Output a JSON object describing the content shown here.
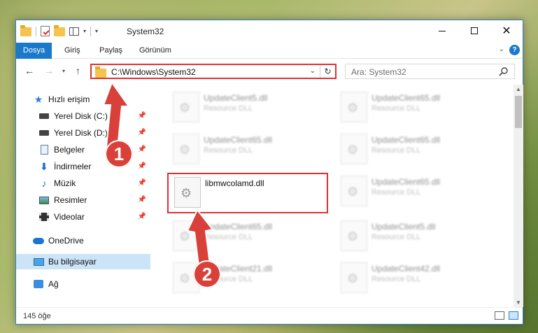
{
  "window": {
    "title": "System32"
  },
  "ribbon": {
    "tabs": [
      "Dosya",
      "Giriş",
      "Paylaş",
      "Görünüm"
    ]
  },
  "address": {
    "path": "C:\\Windows\\System32"
  },
  "search": {
    "placeholder": "Ara: System32"
  },
  "navpane": {
    "items": [
      {
        "label": "Hızlı erişim",
        "icon": "star-icon"
      },
      {
        "label": "Yerel Disk (C:)",
        "icon": "drive-icon",
        "pinned": true
      },
      {
        "label": "Yerel Disk (D:)",
        "icon": "drive-icon",
        "pinned": true
      },
      {
        "label": "Belgeler",
        "icon": "documents-icon",
        "pinned": true
      },
      {
        "label": "İndirmeler",
        "icon": "downloads-icon",
        "pinned": true
      },
      {
        "label": "Müzik",
        "icon": "music-icon",
        "pinned": true
      },
      {
        "label": "Resimler",
        "icon": "pictures-icon",
        "pinned": true
      },
      {
        "label": "Videolar",
        "icon": "videos-icon",
        "pinned": true
      },
      {
        "label": "OneDrive",
        "icon": "onedrive-icon"
      },
      {
        "label": "Bu bilgisayar",
        "icon": "this-pc-icon",
        "selected": true
      },
      {
        "label": "Ağ",
        "icon": "network-icon"
      }
    ]
  },
  "files": [
    {
      "name": "UpdateClient5.dll",
      "type": "Resource DLL"
    },
    {
      "name": "UpdateClient65.dll",
      "type": "Resource DLL"
    },
    {
      "name": "UpdateClient65.dll",
      "type": "Resource DLL"
    },
    {
      "name": "UpdateClient65.dll",
      "type": "Resource DLL"
    },
    {
      "name": "libmwcolamd.dll",
      "type": ""
    },
    {
      "name": "UpdateClient65.dll",
      "type": "Resource DLL"
    },
    {
      "name": "UpdateClient65.dll",
      "type": "Resource DLL"
    },
    {
      "name": "UpdateClient5.dll",
      "type": "Resource DLL"
    },
    {
      "name": "UpdateClient21.dll",
      "type": "Resource DLL"
    },
    {
      "name": "UpdateClient42.dll",
      "type": "Resource DLL"
    }
  ],
  "status": {
    "count": "145 öğe"
  },
  "annotations": {
    "step1": "1",
    "step2": "2",
    "color": "#d9403a"
  }
}
